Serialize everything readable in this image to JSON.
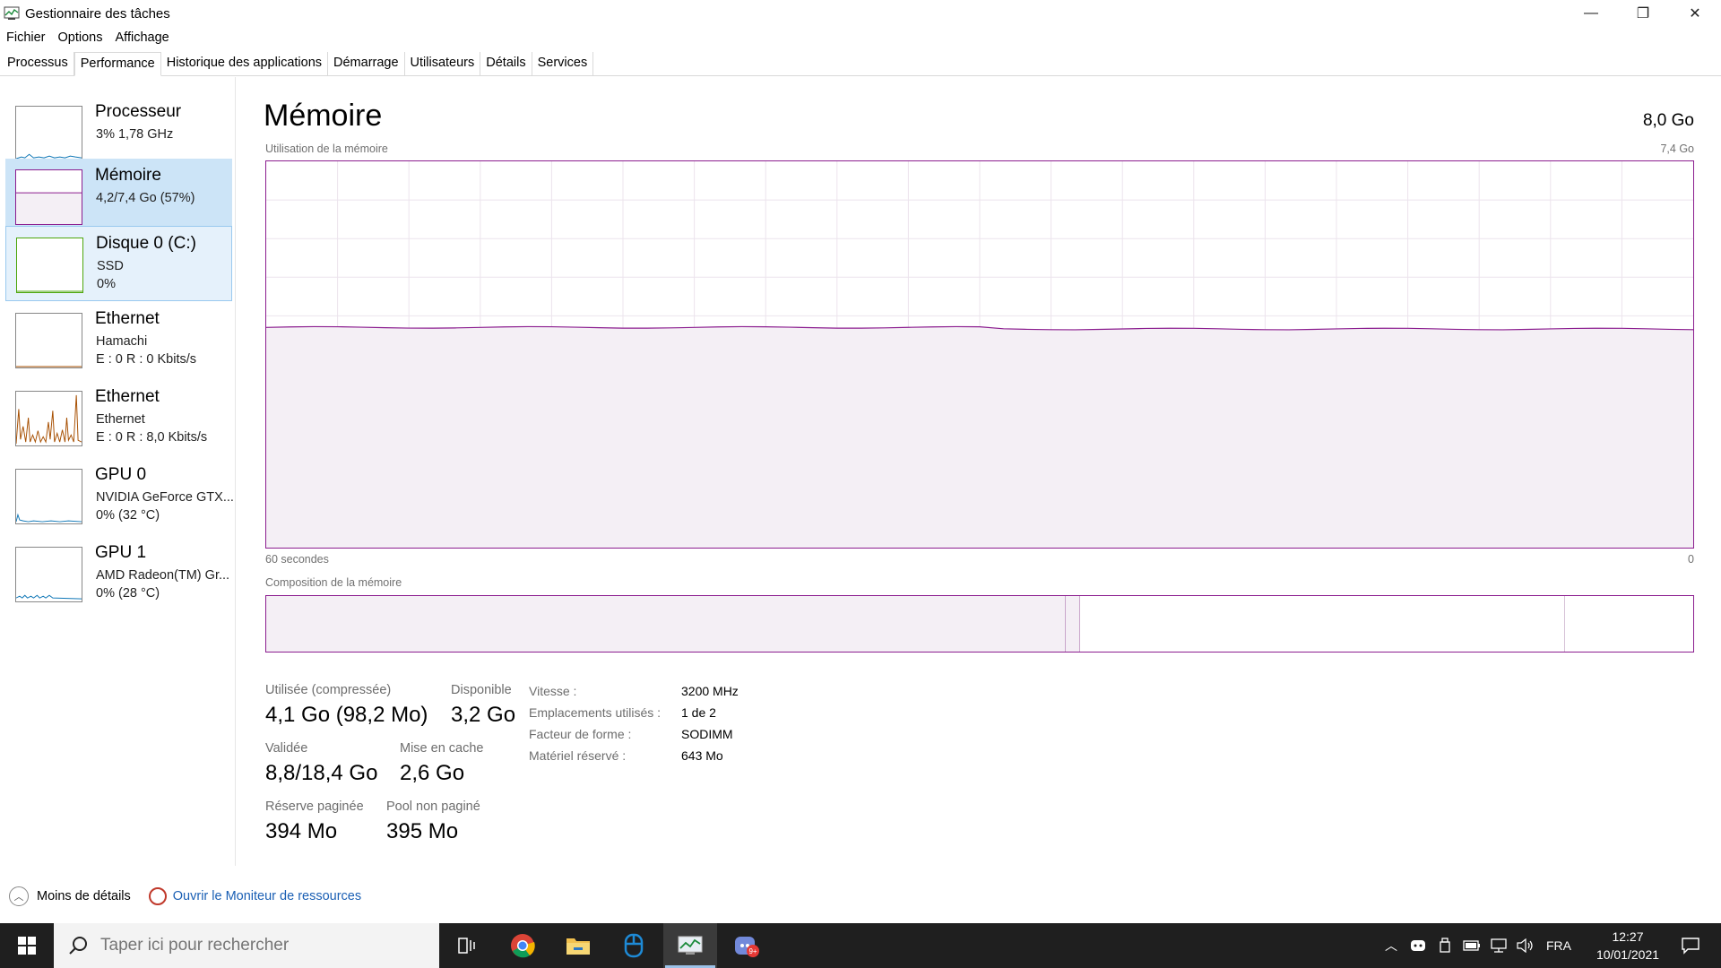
{
  "window": {
    "title": "Gestionnaire des tâches",
    "minimize_glyph": "—",
    "maximize_glyph": "❐",
    "close_glyph": "✕"
  },
  "menu": [
    "Fichier",
    "Options",
    "Affichage"
  ],
  "tabs": [
    {
      "label": "Processus"
    },
    {
      "label": "Performance",
      "active": true
    },
    {
      "label": "Historique des applications"
    },
    {
      "label": "Démarrage"
    },
    {
      "label": "Utilisateurs"
    },
    {
      "label": "Détails"
    },
    {
      "label": "Services"
    }
  ],
  "sidebar": [
    {
      "name": "Processeur",
      "sub1": "3% 1,78 GHz",
      "sub2": "",
      "color": "#1178b7"
    },
    {
      "name": "Mémoire",
      "sub1": "4,2/7,4 Go (57%)",
      "sub2": "",
      "color": "#8b1d8f"
    },
    {
      "name": "Disque 0 (C:)",
      "sub1": "SSD",
      "sub2": "0%",
      "color": "#4da60c"
    },
    {
      "name": "Ethernet",
      "sub1": "Hamachi",
      "sub2": "E : 0 R : 0 Kbits/s",
      "color": "#a74f01"
    },
    {
      "name": "Ethernet",
      "sub1": "Ethernet",
      "sub2": "E : 0 R : 8,0 Kbits/s",
      "color": "#a74f01"
    },
    {
      "name": "GPU 0",
      "sub1": "NVIDIA GeForce GTX...",
      "sub2": "0% (32 °C)",
      "color": "#1178b7"
    },
    {
      "name": "GPU 1",
      "sub1": "AMD Radeon(TM) Gr...",
      "sub2": "0% (28 °C)",
      "color": "#1178b7"
    }
  ],
  "main": {
    "title": "Mémoire",
    "total": "8,0 Go",
    "usage_label": "Utilisation de la mémoire",
    "usage_max": "7,4 Go",
    "time_left": "60 secondes",
    "time_right": "0",
    "composition_label": "Composition de la mémoire",
    "usage_percent": 57,
    "accent": "#8b1d8f",
    "fill": "#f4eff5"
  },
  "composition": {
    "in_use_fraction": 0.56,
    "modified_fraction": 0.011,
    "standby_fraction": 0.34,
    "free_fraction": 0.089
  },
  "stats": {
    "used_label": "Utilisée (compressée)",
    "used_value": "4,1 Go (98,2 Mo)",
    "available_label": "Disponible",
    "available_value": "3,2 Go",
    "committed_label": "Validée",
    "committed_value": "8,8/18,4 Go",
    "cached_label": "Mise en cache",
    "cached_value": "2,6 Go",
    "paged_label": "Réserve paginée",
    "paged_value": "394 Mo",
    "nonpaged_label": "Pool non paginé",
    "nonpaged_value": "395 Mo"
  },
  "details": [
    {
      "label": "Vitesse :",
      "value": "3200 MHz"
    },
    {
      "label": "Emplacements utilisés :",
      "value": "1 de 2"
    },
    {
      "label": "Facteur de forme :",
      "value": "SODIMM"
    },
    {
      "label": "Matériel réservé :",
      "value": "643 Mo"
    }
  ],
  "footer": {
    "less_details": "Moins de détails",
    "resource_monitor": "Ouvrir le Moniteur de ressources"
  },
  "taskbar": {
    "search_placeholder": "Taper ici pour rechercher",
    "language": "FRA",
    "time": "12:27",
    "date": "10/01/2021",
    "discord_badge": "9+"
  }
}
